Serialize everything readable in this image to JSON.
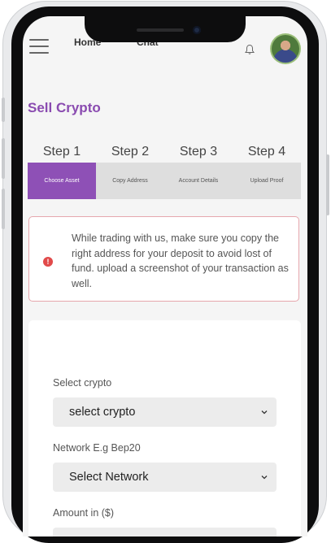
{
  "header": {
    "nav": [
      "Home",
      "Chat"
    ],
    "bell_icon": "bell-icon",
    "menu_icon": "hamburger-menu-icon"
  },
  "page": {
    "title": "Sell Crypto"
  },
  "steps": [
    {
      "label": "Step 1",
      "name": "Choose Asset",
      "active": true
    },
    {
      "label": "Step 2",
      "name": "Copy Address",
      "active": false
    },
    {
      "label": "Step 3",
      "name": "Account Details",
      "active": false
    },
    {
      "label": "Step 4",
      "name": "Upload Proof",
      "active": false
    }
  ],
  "alert": {
    "icon": "error-icon",
    "glyph": "!",
    "text": "While trading with us, make sure you copy the right address for your deposit to avoid lost of fund. upload a screenshot of your transaction as well."
  },
  "form": {
    "crypto_label": "Select crypto",
    "crypto_value": "select crypto",
    "network_label": "Network E.g Bep20",
    "network_value": "Select Network",
    "amount_label": "Amount in ($)"
  },
  "colors": {
    "accent": "#8e50b6",
    "title": "#8a4bb0",
    "alert_border": "#e6a7ad",
    "alert_icon": "#e14a4a"
  }
}
